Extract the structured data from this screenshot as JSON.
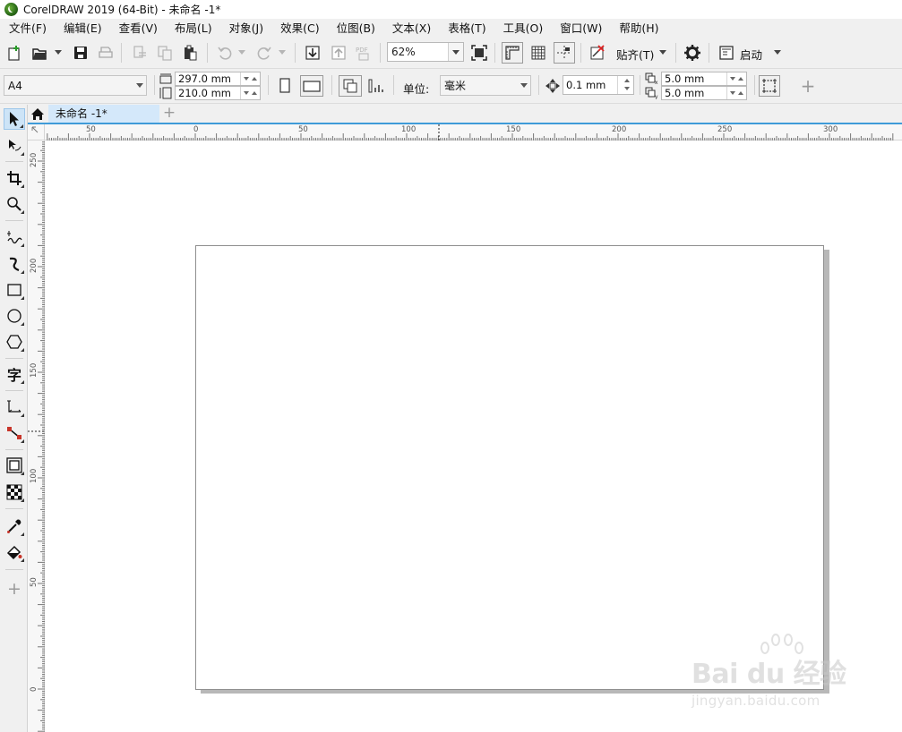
{
  "window": {
    "title": "CorelDRAW 2019 (64-Bit) - 未命名 -1*"
  },
  "menu": [
    {
      "label": "文件(F)"
    },
    {
      "label": "编辑(E)"
    },
    {
      "label": "查看(V)"
    },
    {
      "label": "布局(L)"
    },
    {
      "label": "对象(J)"
    },
    {
      "label": "效果(C)"
    },
    {
      "label": "位图(B)"
    },
    {
      "label": "文本(X)"
    },
    {
      "label": "表格(T)"
    },
    {
      "label": "工具(O)"
    },
    {
      "label": "窗口(W)"
    },
    {
      "label": "帮助(H)"
    }
  ],
  "toolbar": {
    "zoom_value": "62%",
    "snap_label": "贴齐(T)",
    "launch_label": "启动",
    "pdf_label": "PDF"
  },
  "property_bar": {
    "page_size": "A4",
    "width": "297.0 mm",
    "height": "210.0 mm",
    "unit_label": "单位:",
    "unit_value": "毫米",
    "nudge": "0.1 mm",
    "dup_x": "5.0 mm",
    "dup_y": "5.0 mm"
  },
  "tabs": {
    "document_name": "未命名 -1*",
    "add_symbol": "+"
  },
  "toolbox": [
    "pick-tool-icon",
    "shape-tool-icon",
    "crop-tool-icon",
    "zoom-tool-icon",
    "freehand-tool-icon",
    "artistic-media-tool-icon",
    "rectangle-tool-icon",
    "ellipse-tool-icon",
    "polygon-tool-icon",
    "text-tool-icon",
    "dimension-tool-icon",
    "connector-tool-icon",
    "drop-shadow-tool-icon",
    "transparency-tool-icon",
    "eyedropper-tool-icon",
    "interactive-fill-tool-icon",
    "add-tool-icon"
  ],
  "text_tool_glyph": "字",
  "hruler_labels": [
    "50",
    "0",
    "50",
    "100",
    "150",
    "200",
    "250",
    "300"
  ],
  "vruler_labels": [
    "250",
    "200",
    "150",
    "100",
    "50",
    "0"
  ],
  "colors": {
    "accent": "#3f9bd8",
    "tab_active": "#d4e8fa",
    "tool_active": "#cde4f7"
  },
  "watermark": {
    "brand": "Bai du 经验",
    "url": "jingyan.baidu.com"
  }
}
